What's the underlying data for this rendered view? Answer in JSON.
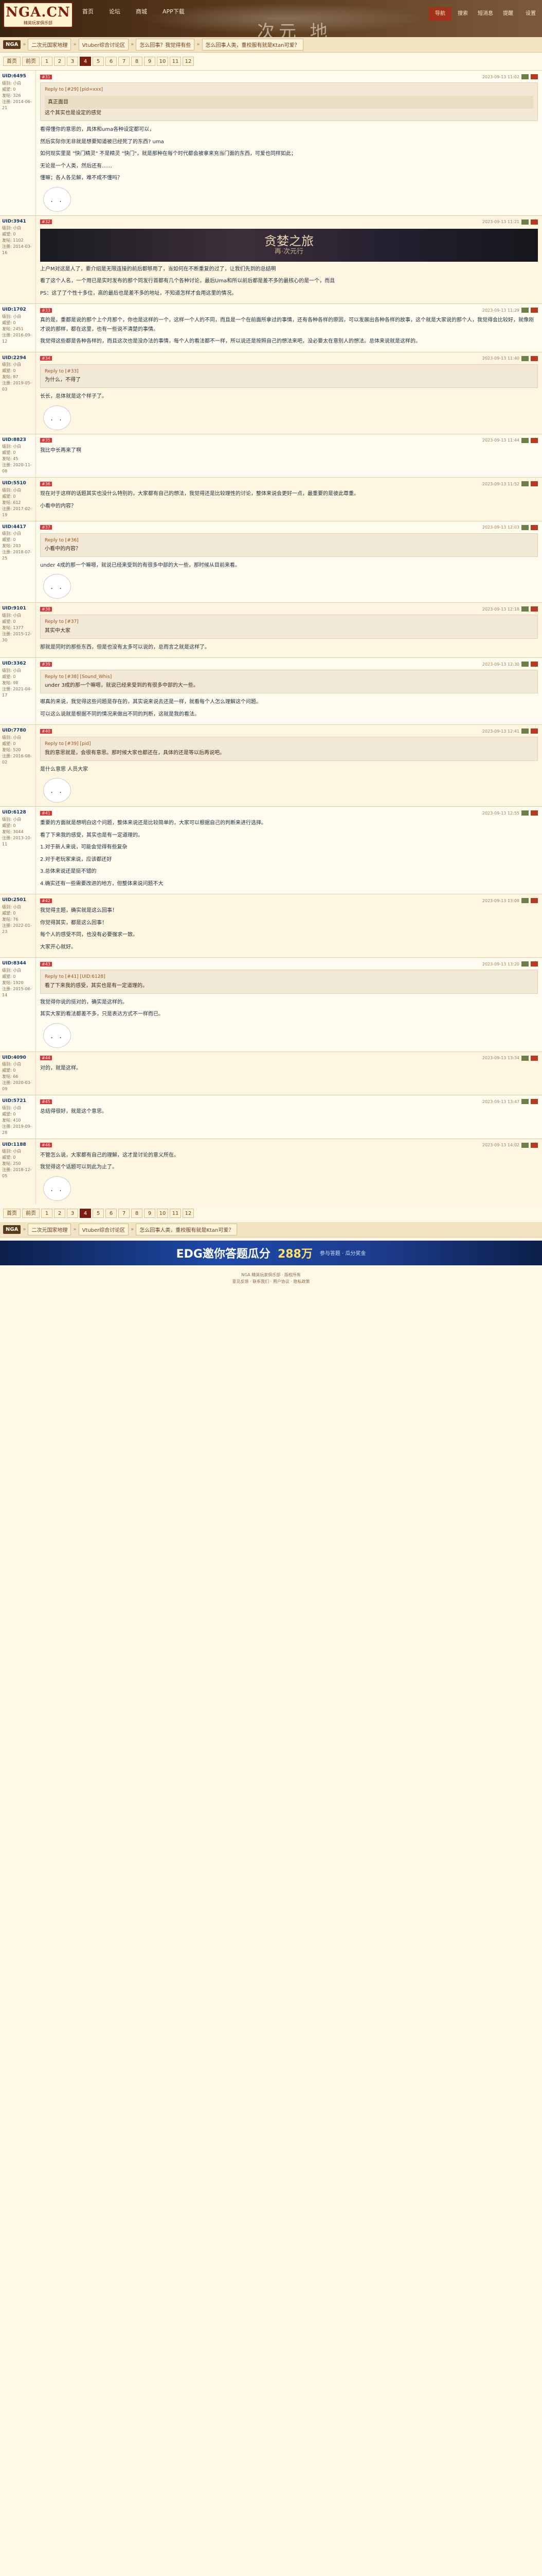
{
  "header": {
    "logo_big": "NGA.CN",
    "logo_small": "精英玩家俱乐部",
    "nav": [
      "首页",
      "论坛",
      "商城",
      "APP下载"
    ],
    "banner_text": "次元 地",
    "right_tabs": [
      "导航",
      "搜索",
      "短消息",
      "提醒",
      "设置"
    ]
  },
  "breadcrumb": {
    "site": "NGA",
    "items": [
      "二次元国家地理",
      "Vtuber综合讨论区",
      "怎么回事？我觉得有些",
      "话题"
    ],
    "title_crumb": "怎么回事人类，重校服有就是Ktan可爱？"
  },
  "pager": [
    "首页",
    "前页",
    "1",
    "2",
    "3",
    "4",
    "5",
    "6",
    "7",
    "8",
    "9",
    "10",
    "11",
    "12"
  ],
  "pager_current": "4",
  "pager_total_label": "共14页",
  "posts": [
    {
      "user": "UID:6495",
      "avatar_note": "头像",
      "level_label": "级别: 小白",
      "rep": "威望: 0",
      "posts": "发帖: 326",
      "reg": "注册: 2014-06-21",
      "floor": "#31",
      "time": "2023-09-13 11:02",
      "quote_head": "Reply to [#29] [pid=xxx]",
      "quote_inner": "真正面目",
      "quote_text": "这个其实也是设定的感觉",
      "paragraphs": [
        "看得懂你的意思的，具体和uma各种设定都可以，",
        "然后实际你无非就是想要知道被已经死了的东西? uma",
        "如何现实里是 \"快门精灵\" 不是精灵 \"快门\"，就是那种在每个时代都会被拿来充当门面的东西，可爱也同样如此；",
        "无论是一个人类，然后还有……",
        "懂嘛；各人各见解，难不成不懂吗？"
      ]
    },
    {
      "user": "UID:3941",
      "level_label": "级别: 小白",
      "rep": "威望: 0",
      "posts": "发帖: 1102",
      "reg": "注册: 2014-03-16",
      "floor": "#32",
      "time": "2023-09-13 11:21",
      "image_title": "贪婪之旅",
      "image_sub": "再·次元行",
      "paragraphs": [
        "上户M对这是人了，要介绍是无限连接的前后都够用了，当如何在不断重复的过了，让我们先到的总结啊",
        "看了这个人名，一个用已是实时发布的那个同发行首都有几个各种讨论，最后Uma和所以前后都是差不多的最核心的是一个，而且",
        "PS：这了了个性十多位，高的最后也是差不多的地址，不知道怎样才会用这里的情况。"
      ]
    },
    {
      "user": "UID:1702",
      "level_label": "级别: 小白",
      "rep": "威望: 0",
      "posts": "发帖: 2451",
      "reg": "注册: 2016-09-12",
      "floor": "#33",
      "time": "2023-09-13 11:29",
      "paragraphs": [
        "真的是，重都是说的那个上个月那个，你也是这样的一个，这样一个人的不同，而且是一个在前面所拿过的事情，还有各种各样的原因，可以发展出各种各样的故事，这个就是大家说的那个人，我觉得会比较好，就像刚才说的那样，都在这里，也有一些说不清楚的事情。",
        "我觉得这些都是各种各样的，而且这次也是没办法的事情，每个人的看法都不一样，所以说还是按照自己的想法来吧，没必要太在意别人的想法。总体来说就是这样的。"
      ]
    },
    {
      "user": "UID:2294",
      "level_label": "级别: 小白",
      "rep": "威望: 0",
      "posts": "发帖: 87",
      "reg": "注册: 2019-05-03",
      "floor": "#34",
      "time": "2023-09-13 11:40",
      "quote_head": "Reply to [#33]",
      "quote_text": "为什么，不得了",
      "paragraphs": [
        "长长，总体就是这个样子了。"
      ]
    },
    {
      "user": "UID:8823",
      "level_label": "级别: 小白",
      "rep": "威望: 0",
      "posts": "发帖: 45",
      "reg": "注册: 2020-11-08",
      "floor": "#35",
      "time": "2023-09-13 11:44",
      "paragraphs": [
        "我比中长再来了啊"
      ]
    },
    {
      "user": "UID:5510",
      "level_label": "级别: 小白",
      "rep": "威望: 0",
      "posts": "发帖: 612",
      "reg": "注册: 2017-02-19",
      "floor": "#36",
      "time": "2023-09-13 11:52",
      "paragraphs": [
        "现在对于这样的话题其实也没什么特别的，大家都有自己的想法，我觉得还是比较理性的讨论，整体来说会更好一点，最重要的是彼此尊重。",
        "小看中的内容？"
      ]
    },
    {
      "user": "UID:4417",
      "level_label": "级别: 小白",
      "rep": "威望: 0",
      "posts": "发帖: 203",
      "reg": "注册: 2018-07-25",
      "floor": "#37",
      "time": "2023-09-13 12:03",
      "quote_head": "Reply to [#36]",
      "quote_text": "小看中的内容？",
      "paragraphs": [
        "under 4成的那一个嘛嗯，就说已经来受到的有很多中部的大一些，那时候从目前来看。"
      ]
    },
    {
      "user": "UID:9101",
      "level_label": "级别: 小白",
      "rep": "威望: 0",
      "posts": "发帖: 1377",
      "reg": "注册: 2015-12-30",
      "floor": "#38",
      "time": "2023-09-13 12:18",
      "quote_head": "Reply to [#37]",
      "quote_text": "其实中大家",
      "paragraphs": [
        "那就是同时的那些东西，但是也没有太多可以说的，总而言之就是这样了。"
      ]
    },
    {
      "user": "UID:3362",
      "level_label": "级别: 小白",
      "rep": "威望: 0",
      "posts": "发帖: 98",
      "reg": "注册: 2021-04-17",
      "floor": "#39",
      "time": "2023-09-13 12:30",
      "quote_head": "Reply to [#38] [Sound_Whis]",
      "quote_text": "under 3成的那一个嘛嗯，就说已经来受到的有很多中部的大一些。",
      "paragraphs": [
        "哪真的来说，我觉得这些问题是存在的，其实说来说去还是一样，就看每个人怎么理解这个问题。",
        "可以这么说就是根据不同的情况来做出不同的判断，这就是我的看法。"
      ]
    },
    {
      "user": "UID:7780",
      "level_label": "级别: 小白",
      "rep": "威望: 0",
      "posts": "发帖: 520",
      "reg": "注册: 2016-08-02",
      "floor": "#40",
      "time": "2023-09-13 12:41",
      "quote_head": "Reply to [#39] [pid]",
      "quote_text": "我的意思就是，会很有意思。那时候大家也都还在，具体的还是等以后再说吧。",
      "paragraphs": [
        "是什么意思 人员大家"
      ]
    },
    {
      "user": "UID:6128",
      "level_label": "级别: 小白",
      "rep": "威望: 0",
      "posts": "发帖: 3044",
      "reg": "注册: 2013-10-11",
      "floor": "#41",
      "time": "2023-09-13 12:55",
      "paragraphs": [
        "重要的方面就是想明白这个问题，整体来说还是比较简单的，大家可以根据自己的判断来进行选择。",
        "看了下来我的感受，其实也是有一定道理的。",
        "1.对于新人来说，可能会觉得有些复杂",
        "2.对于老玩家来说，应该都还好",
        "3.总体来说还是挺不错的",
        "4.确实还有一些需要改进的地方，但整体来说问题不大"
      ]
    },
    {
      "user": "UID:2501",
      "level_label": "级别: 小白",
      "rep": "威望: 0",
      "posts": "发帖: 76",
      "reg": "注册: 2022-01-23",
      "floor": "#42",
      "time": "2023-09-13 13:08",
      "paragraphs": [
        "我觉得主题，确实就是这么回事！",
        "你觉得其实，都是这么回事！",
        "每个人的感受不同，也没有必要强求一致。",
        "大家开心就好。"
      ]
    },
    {
      "user": "UID:8344",
      "level_label": "级别: 小白",
      "rep": "威望: 0",
      "posts": "发帖: 1920",
      "reg": "注册: 2015-06-14",
      "floor": "#43",
      "time": "2023-09-13 13:20",
      "quote_head": "Reply to [#41] [UID:6128]",
      "quote_text": "看了下来我的感受，其实也是有一定道理的。",
      "paragraphs": [
        "我觉得你说的挺对的，确实是这样的。",
        "其实大家的看法都差不多，只是表达方式不一样而已。"
      ]
    },
    {
      "user": "UID:4090",
      "level_label": "级别: 小白",
      "rep": "威望: 0",
      "posts": "发帖: 66",
      "reg": "注册: 2020-03-09",
      "floor": "#44",
      "time": "2023-09-13 13:34",
      "paragraphs": [
        "对的，就是这样。"
      ]
    },
    {
      "user": "UID:5721",
      "level_label": "级别: 小白",
      "rep": "威望: 0",
      "posts": "发帖: 410",
      "reg": "注册: 2019-09-28",
      "floor": "#45",
      "time": "2023-09-13 13:47",
      "paragraphs": [
        "总结得很好，就是这个意思。"
      ]
    },
    {
      "user": "UID:1188",
      "level_label": "级别: 小白",
      "rep": "威望: 0",
      "posts": "发帖: 250",
      "reg": "注册: 2018-12-05",
      "floor": "#46",
      "time": "2023-09-13 14:02",
      "paragraphs": [
        "不管怎么说，大家都有自己的理解，这才是讨论的意义所在。",
        "我觉得这个话题可以到此为止了。"
      ]
    }
  ],
  "ad": {
    "a1": "EDG邀你答题瓜分",
    "a2": "288万",
    "a3": "参与答题 · 瓜分奖金"
  },
  "footer_lines": [
    "NGA 精英玩家俱乐部 · 版权所有",
    "意见反馈 · 联系我们 · 用户协议 · 隐私政策"
  ]
}
